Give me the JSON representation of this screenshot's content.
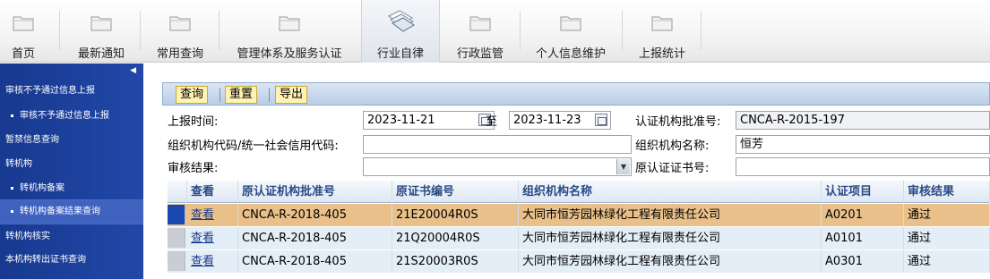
{
  "nav": {
    "items": [
      {
        "label": "首页",
        "icon": "folder-icon"
      },
      {
        "label": "最新通知",
        "icon": "folder-icon"
      },
      {
        "label": "常用查询",
        "icon": "folder-icon"
      },
      {
        "label": "管理体系及服务认证",
        "icon": "folder-icon"
      },
      {
        "label": "行业自律",
        "icon": "documents-icon",
        "active": true
      },
      {
        "label": "行政监管",
        "icon": "folder-icon"
      },
      {
        "label": "个人信息维护",
        "icon": "folder-icon"
      },
      {
        "label": "上报统计",
        "icon": "folder-icon"
      }
    ]
  },
  "sidebar": {
    "collapse_icon": "◀",
    "items": [
      {
        "label": "审核不予通过信息上报"
      },
      {
        "label": "审核不予通过信息上报"
      },
      {
        "label": "暂禁信息查询"
      },
      {
        "label": "转机构"
      },
      {
        "label": "转机构备案"
      },
      {
        "label": "转机构备案结果查询"
      },
      {
        "label": "转机构核实"
      },
      {
        "label": "本机构转出证书查询"
      }
    ]
  },
  "toolbar": {
    "query": "查询",
    "reset": "重置",
    "export": "导出"
  },
  "form": {
    "report_time_label": "上报时间:",
    "date_from": "2023-11-21",
    "to_label": "至",
    "date_to": "2023-11-23",
    "approval_no_label": "认证机构批准号:",
    "approval_no": "CNCA-R-2015-197",
    "org_code_label": "组织机构代码/统一社会信用代码:",
    "org_code": "",
    "org_name_label": "组织机构名称:",
    "org_name": "恒芳",
    "audit_result_label": "审核结果:",
    "audit_result": "",
    "orig_cert_no_label": "原认证证书号:",
    "orig_cert_no": ""
  },
  "table": {
    "headers": [
      "查看",
      "原认证机构批准号",
      "原证书编号",
      "组织机构名称",
      "认证项目",
      "审核结果"
    ],
    "rows": [
      {
        "view": "查看",
        "approval": "CNCA-R-2018-405",
        "cert": "21E20004R0S",
        "org": "大同市恒芳园林绿化工程有限责任公司",
        "item": "A0201",
        "result": "通过"
      },
      {
        "view": "查看",
        "approval": "CNCA-R-2018-405",
        "cert": "21Q20004R0S",
        "org": "大同市恒芳园林绿化工程有限责任公司",
        "item": "A0101",
        "result": "通过"
      },
      {
        "view": "查看",
        "approval": "CNCA-R-2018-405",
        "cert": "21S20003R0S",
        "org": "大同市恒芳园林绿化工程有限责任公司",
        "item": "A0301",
        "result": "通过"
      }
    ]
  },
  "colors": {
    "sidebar_bg": "#1c3f9a",
    "selected_row": "#e9c08a",
    "toolbar_button": "#fff2b3"
  }
}
